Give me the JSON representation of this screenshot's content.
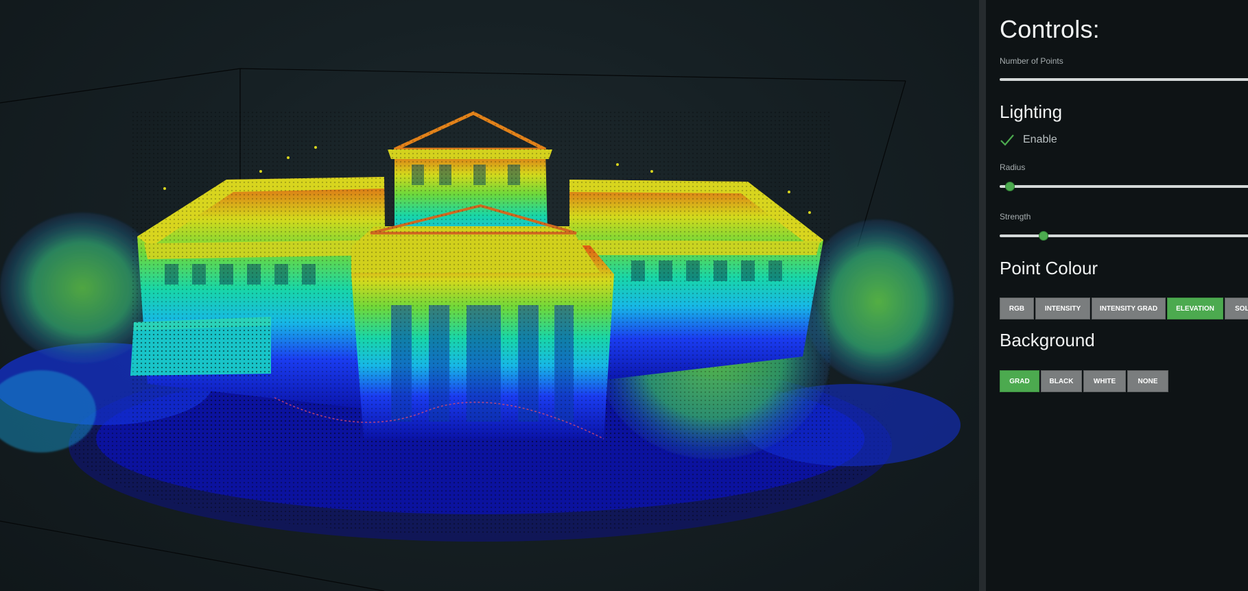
{
  "panel": {
    "title": "Controls:",
    "num_points_label": "Number of Points",
    "lighting": {
      "heading": "Lighting",
      "enable_label": "Enable",
      "enabled": true,
      "radius_label": "Radius",
      "radius_level": 0.02,
      "strength_label": "Strength",
      "strength_level": 0.15
    },
    "point_colour": {
      "heading": "Point Colour",
      "options": [
        "RGB",
        "INTENSITY",
        "INTENSITY GRAD",
        "ELEVATION",
        "SOLI"
      ],
      "selected": "ELEVATION"
    },
    "background": {
      "heading": "Background",
      "options": [
        "GRAD",
        "BLACK",
        "WHITE",
        "NONE"
      ],
      "selected": "GRAD"
    }
  },
  "colors": {
    "accent": "#4caa4f",
    "button": "#7a7d7e",
    "panel_bg": "#0e1315"
  }
}
